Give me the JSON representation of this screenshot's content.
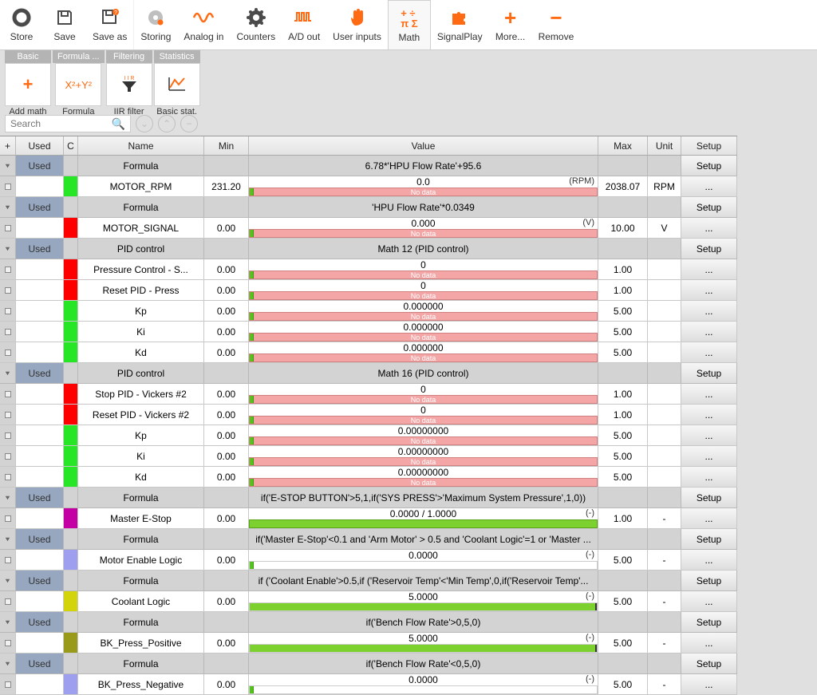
{
  "toolbar": {
    "store": "Store",
    "save": "Save",
    "saveas": "Save as",
    "storing": "Storing",
    "analogin": "Analog in",
    "counters": "Counters",
    "adout": "A/D out",
    "userinputs": "User inputs",
    "math": "Math",
    "signalplay": "SignalPlay",
    "more": "More...",
    "remove": "Remove"
  },
  "subgroups": {
    "basic": "Basic",
    "formula": "Formula ...",
    "filtering": "Filtering",
    "statistics": "Statistics",
    "addmath": "Add math",
    "formulabtn": "Formula",
    "iir": "IIR filter",
    "basicstat": "Basic stat."
  },
  "search_placeholder": "Search",
  "headers": {
    "plus": "+",
    "used": "Used",
    "c": "C",
    "name": "Name",
    "min": "Min",
    "value": "Value",
    "max": "Max",
    "unit": "Unit",
    "setup": "Setup"
  },
  "setup_label": "Setup",
  "dots_label": "...",
  "nodata": "No data",
  "groups": [
    {
      "used": "Used",
      "type": "Formula",
      "value": "6.78*'HPU Flow Rate'+95.6",
      "rows": [
        {
          "color": "#26e626",
          "name": "MOTOR_RPM",
          "min": "231.20",
          "val": "0.0",
          "tag": "(RPM)",
          "bar": "pink",
          "max": "2038.07",
          "unit": "RPM"
        }
      ]
    },
    {
      "used": "Used",
      "type": "Formula",
      "value": "'HPU Flow Rate'*0.0349",
      "rows": [
        {
          "color": "#ff0000",
          "name": "MOTOR_SIGNAL",
          "min": "0.00",
          "val": "0.000",
          "tag": "(V)",
          "bar": "pink",
          "max": "10.00",
          "unit": "V"
        }
      ]
    },
    {
      "used": "Used",
      "type": "PID control",
      "value": "Math 12 (PID control)",
      "rows": [
        {
          "color": "#ff0000",
          "name": "Pressure Control - S...",
          "min": "0.00",
          "val": "0",
          "bar": "pink",
          "max": "1.00",
          "unit": ""
        },
        {
          "color": "#ff0000",
          "name": "Reset PID - Press",
          "min": "0.00",
          "val": "0",
          "bar": "pink",
          "max": "1.00",
          "unit": ""
        },
        {
          "color": "#26e626",
          "name": "Kp",
          "min": "0.00",
          "val": "0.000000",
          "bar": "pink",
          "max": "5.00",
          "unit": ""
        },
        {
          "color": "#26e626",
          "name": "Ki",
          "min": "0.00",
          "val": "0.000000",
          "bar": "pink",
          "max": "5.00",
          "unit": ""
        },
        {
          "color": "#26e626",
          "name": "Kd",
          "min": "0.00",
          "val": "0.000000",
          "bar": "pink",
          "max": "5.00",
          "unit": ""
        }
      ]
    },
    {
      "used": "Used",
      "type": "PID control",
      "value": "Math 16 (PID control)",
      "rows": [
        {
          "color": "#ff0000",
          "name": "Stop PID - Vickers #2",
          "min": "0.00",
          "val": "0",
          "bar": "pink",
          "max": "1.00",
          "unit": ""
        },
        {
          "color": "#ff0000",
          "name": "Reset PID - Vickers #2",
          "min": "0.00",
          "val": "0",
          "bar": "pink",
          "max": "1.00",
          "unit": ""
        },
        {
          "color": "#26e626",
          "name": "Kp",
          "min": "0.00",
          "val": "0.00000000",
          "bar": "pink",
          "max": "5.00",
          "unit": ""
        },
        {
          "color": "#26e626",
          "name": "Ki",
          "min": "0.00",
          "val": "0.00000000",
          "bar": "pink",
          "max": "5.00",
          "unit": ""
        },
        {
          "color": "#26e626",
          "name": "Kd",
          "min": "0.00",
          "val": "0.00000000",
          "bar": "pink",
          "max": "5.00",
          "unit": ""
        }
      ]
    },
    {
      "used": "Used",
      "type": "Formula",
      "value": "if('E-STOP BUTTON'>5,1,if('SYS PRESS'>'Maximum System Pressure',1,0))",
      "rows": [
        {
          "color": "#c400a4",
          "name": "Master E-Stop",
          "min": "0.00",
          "val": "0.0000 / 1.0000",
          "tag": "(-)",
          "bar": "green",
          "max": "1.00",
          "unit": "-"
        }
      ]
    },
    {
      "used": "Used",
      "type": "Formula",
      "value": "if('Master E-Stop'<0.1 and 'Arm Motor'  > 0.5 and 'Coolant Logic'=1 or 'Master ...",
      "rows": [
        {
          "color": "#9f9ff0",
          "name": "Motor Enable Logic",
          "min": "0.00",
          "val": "0.0000",
          "tag": "(-)",
          "bar": "none",
          "max": "5.00",
          "unit": "-"
        }
      ]
    },
    {
      "used": "Used",
      "type": "Formula",
      "value": "if ('Coolant Enable'>0.5,if ('Reservoir Temp'<'Min Temp',0,if('Reservoir Temp'...",
      "rows": [
        {
          "color": "#d4d40a",
          "name": "Coolant Logic",
          "min": "0.00",
          "val": "5.0000",
          "tag": "(-)",
          "bar": "half",
          "max": "5.00",
          "unit": "-"
        }
      ]
    },
    {
      "used": "Used",
      "type": "Formula",
      "value": "if('Bench Flow Rate'>0,5,0)",
      "rows": [
        {
          "color": "#9a9a1a",
          "name": "BK_Press_Positive",
          "min": "0.00",
          "val": "5.0000",
          "tag": "(-)",
          "bar": "half",
          "max": "5.00",
          "unit": "-"
        }
      ]
    },
    {
      "used": "Used",
      "type": "Formula",
      "value": "if('Bench Flow Rate'<0,5,0)",
      "rows": [
        {
          "color": "#9f9ff0",
          "name": "BK_Press_Negative",
          "min": "0.00",
          "val": "0.0000",
          "tag": "(-)",
          "bar": "none",
          "max": "5.00",
          "unit": "-"
        }
      ]
    }
  ]
}
